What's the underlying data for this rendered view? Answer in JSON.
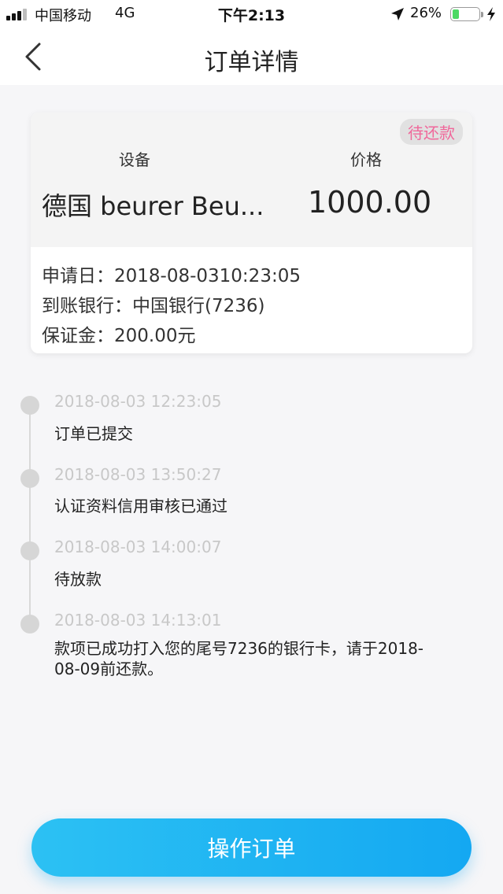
{
  "status_bar": {
    "carrier": "中国移动",
    "network": "4G",
    "time": "下午2:13",
    "battery_percent": "26%",
    "battery_level": 0.26,
    "icons": [
      "signal-icon",
      "location-arrow-icon",
      "battery-icon",
      "charging-bolt-icon"
    ]
  },
  "nav": {
    "title": "订单详情",
    "back_icon": "chevron-left-icon"
  },
  "order": {
    "status_badge": "待还款",
    "device_label": "设备",
    "price_label": "价格",
    "device_name": "德国 beurer Beu...",
    "price": "1000.00",
    "apply_date": "申请日：2018-08-0310:23:05",
    "bank": "到账银行：中国银行(7236)",
    "deposit": "保证金：200.00元"
  },
  "timeline": [
    {
      "time": "2018-08-03 12:23:05",
      "text": "订单已提交"
    },
    {
      "time": "2018-08-03 13:50:27",
      "text": "认证资料信用审核已通过"
    },
    {
      "time": "2018-08-03 14:00:07",
      "text": "待放款"
    },
    {
      "time": "2018-08-03 14:13:01",
      "text": "款项已成功打入您的尾号7236的银行卡，请于2018-08-09前还款。"
    }
  ],
  "action": {
    "label": "操作订单"
  },
  "colors": {
    "accent": "#1aaef2",
    "badge_text": "#f0679a",
    "timeline_dot": "#d6d6d6"
  }
}
